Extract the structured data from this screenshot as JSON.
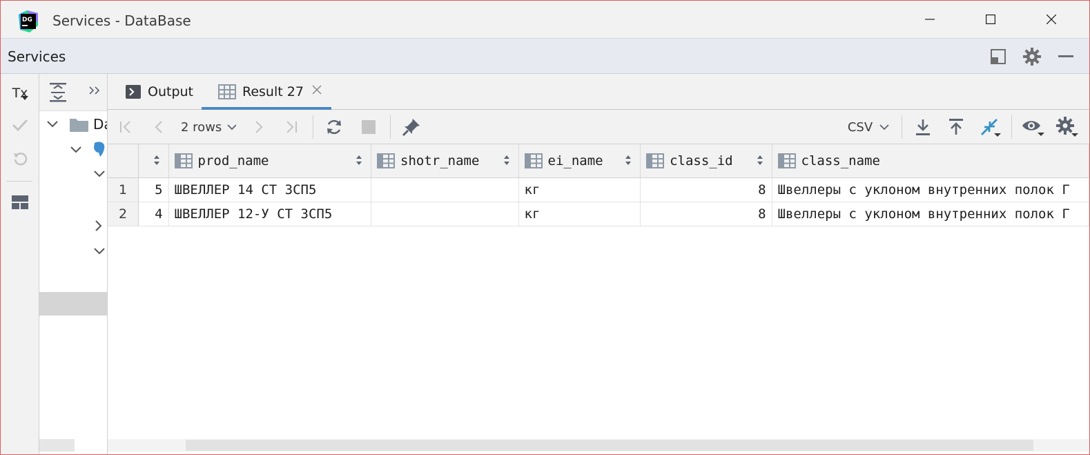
{
  "window": {
    "title": "Services - DataBase",
    "app_logo_text": "DG"
  },
  "services_panel": {
    "title": "Services"
  },
  "left_strip": {
    "tx_label": "Tx"
  },
  "tree": {
    "visible_item_label": "Da"
  },
  "tabs": [
    {
      "label": "Output",
      "icon": "console-icon"
    },
    {
      "label": "Result 27",
      "icon": "table-icon",
      "active": true
    }
  ],
  "grid_toolbar": {
    "rows_label": "2 rows",
    "export_format": "CSV"
  },
  "table": {
    "columns": [
      "",
      "prod_name",
      "shotr_name",
      "ei_name",
      "class_id",
      "class_name"
    ],
    "rows": [
      {
        "row_num": "1",
        "id": "5",
        "prod_name": "ШВЕЛЛЕР 14 СТ 3СП5",
        "shotr_name": "",
        "ei_name": "кг",
        "class_id": "8",
        "class_name": "Швеллеры с уклоном внутренних полок Г"
      },
      {
        "row_num": "2",
        "id": "4",
        "prod_name": "ШВЕЛЛЕР 12-У СТ 3СП5",
        "shotr_name": "",
        "ei_name": "кг",
        "class_id": "8",
        "class_name": "Швеллеры с уклоном внутренних полок Г"
      }
    ]
  },
  "colors": {
    "accent": "#4a88c7",
    "toolbar_bg": "#f2f2f2",
    "services_bar_bg": "#e7ebf1",
    "window_border": "#e05a5a"
  }
}
